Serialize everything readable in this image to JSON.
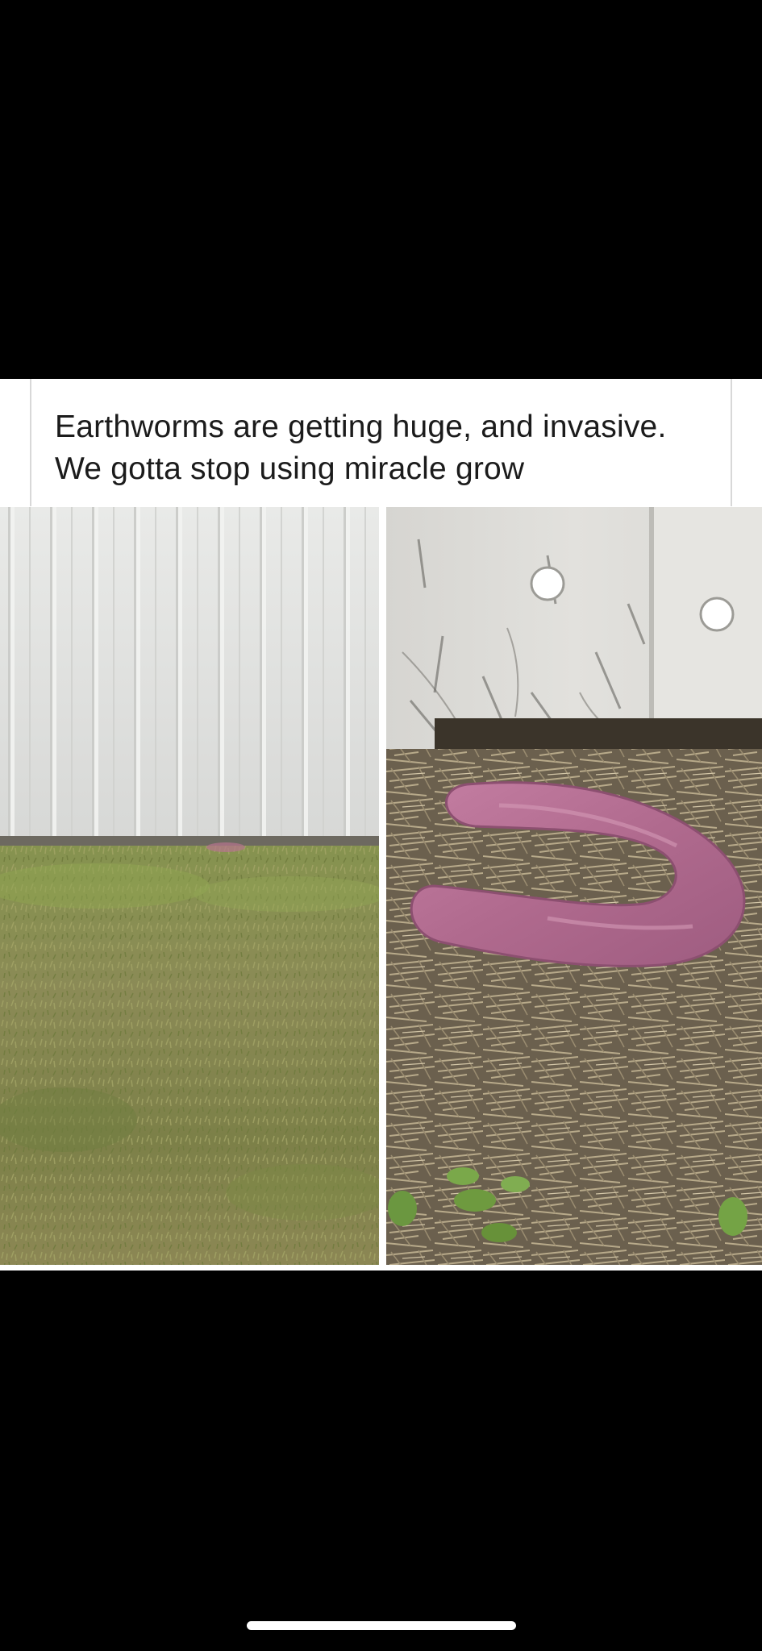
{
  "caption": {
    "line1": "Earthworms are getting huge, and invasive.",
    "line2": "We gotta stop using miracle grow"
  },
  "photos": {
    "left": "photo-siding-and-lawn",
    "right": "photo-pink-object-on-straw"
  },
  "colors": {
    "background": "#000000",
    "caption_background": "#ffffff",
    "caption_text": "#1b1b1b",
    "siding": "#e4e5e3",
    "grass": "#7f8a4e",
    "straw": "#8c7e66",
    "pink_object": "#b16a8e"
  }
}
